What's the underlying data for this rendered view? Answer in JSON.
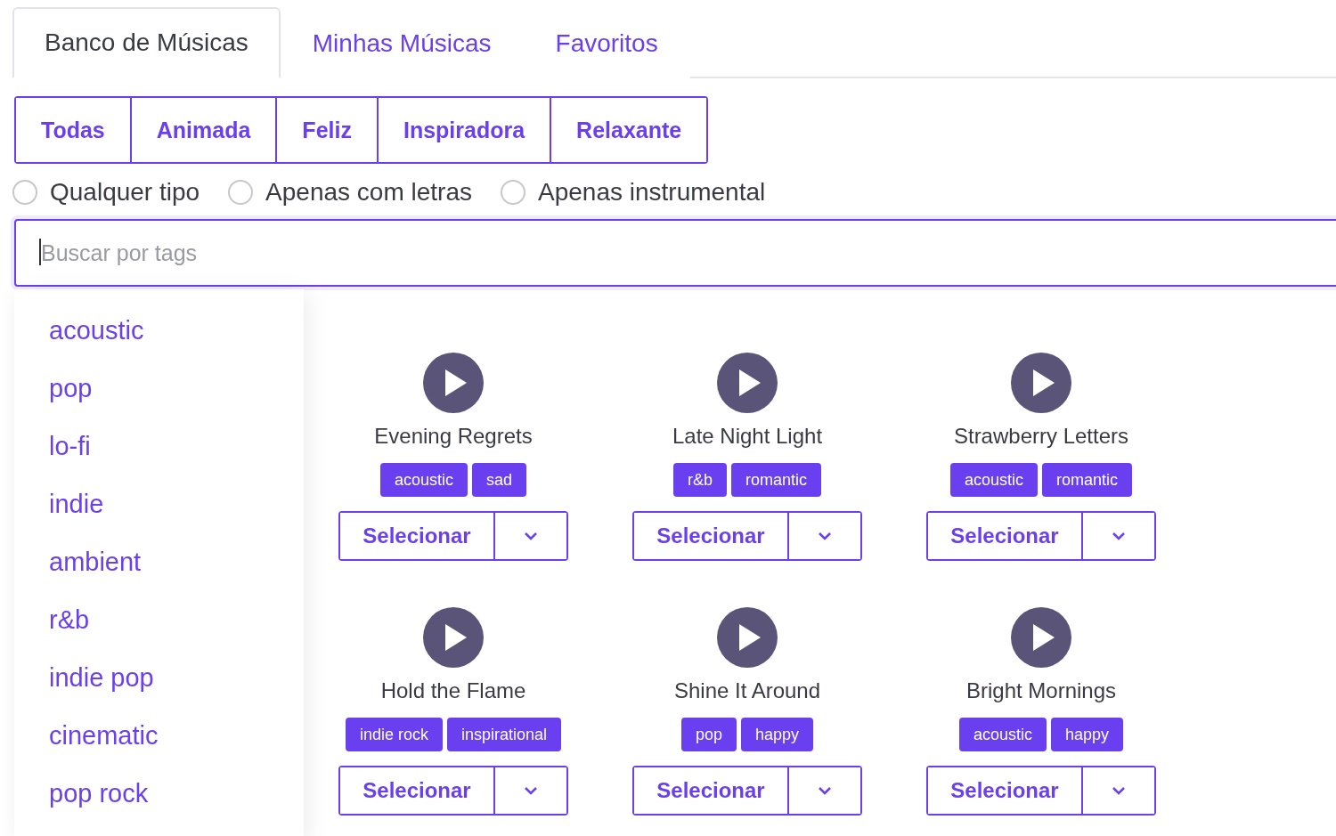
{
  "tabs": [
    {
      "label": "Banco de Músicas",
      "selected": true
    },
    {
      "label": "Minhas Músicas",
      "selected": false
    },
    {
      "label": "Favoritos",
      "selected": false
    }
  ],
  "moods": [
    "Todas",
    "Animada",
    "Feliz",
    "Inspiradora",
    "Relaxante"
  ],
  "lyric_filter": [
    {
      "label": "Qualquer tipo",
      "selected": false
    },
    {
      "label": "Apenas com letras",
      "selected": false
    },
    {
      "label": "Apenas instrumental",
      "selected": false
    }
  ],
  "search": {
    "placeholder": "Buscar por tags"
  },
  "tag_suggestions": [
    "acoustic",
    "pop",
    "lo-fi",
    "indie",
    "ambient",
    "r&b",
    "indie pop",
    "cinematic",
    "pop rock"
  ],
  "songs": [
    {
      "title": "Evening Regrets",
      "tags": [
        "acoustic",
        "sad"
      ],
      "button": "Selecionar"
    },
    {
      "title": "Late Night Light",
      "tags": [
        "r&b",
        "romantic"
      ],
      "button": "Selecionar"
    },
    {
      "title": "Strawberry Letters",
      "tags": [
        "acoustic",
        "romantic"
      ],
      "button": "Selecionar"
    },
    {
      "title": "Hold the Flame",
      "tags": [
        "indie rock",
        "inspirational"
      ],
      "button": "Selecionar"
    },
    {
      "title": "Shine It Around",
      "tags": [
        "pop",
        "happy"
      ],
      "button": "Selecionar"
    },
    {
      "title": "Bright Mornings",
      "tags": [
        "acoustic",
        "happy"
      ],
      "button": "Selecionar"
    }
  ]
}
